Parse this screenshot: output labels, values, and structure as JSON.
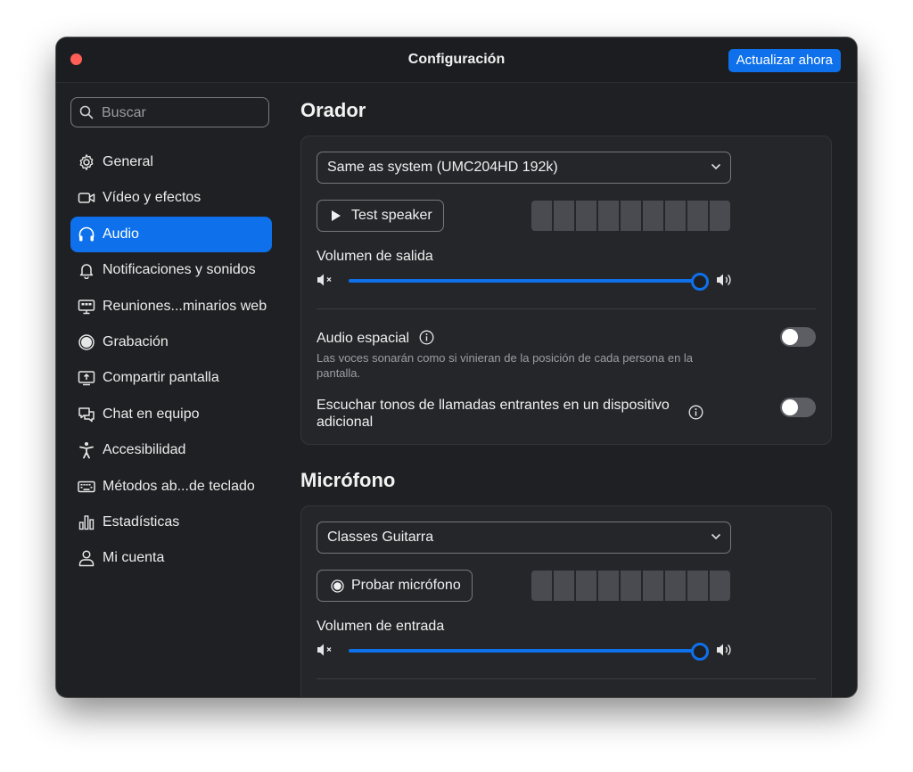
{
  "window": {
    "title": "Configuración",
    "update_button": "Actualizar ahora"
  },
  "search": {
    "placeholder": "Buscar"
  },
  "sidebar": {
    "items": [
      {
        "label": "General",
        "icon": "gear-icon"
      },
      {
        "label": "Vídeo y efectos",
        "icon": "video-icon"
      },
      {
        "label": "Audio",
        "icon": "headphones-icon",
        "active": true
      },
      {
        "label": "Notificaciones y sonidos",
        "icon": "bell-icon"
      },
      {
        "label": "Reuniones...minarios web",
        "icon": "meeting-icon"
      },
      {
        "label": "Grabación",
        "icon": "record-icon"
      },
      {
        "label": "Compartir pantalla",
        "icon": "share-screen-icon"
      },
      {
        "label": "Chat en equipo",
        "icon": "chat-icon"
      },
      {
        "label": "Accesibilidad",
        "icon": "accessibility-icon"
      },
      {
        "label": "Métodos ab...de teclado",
        "icon": "keyboard-icon"
      },
      {
        "label": "Estadísticas",
        "icon": "stats-icon"
      },
      {
        "label": "Mi cuenta",
        "icon": "person-icon"
      }
    ]
  },
  "speaker": {
    "title": "Orador",
    "device": "Same as system (UMC204HD 192k)",
    "test_button": "Test speaker",
    "volume_label": "Volumen de salida",
    "volume_level": 1.0,
    "spatial_label": "Audio espacial",
    "spatial_desc": "Las voces sonarán como si vinieran de la posición de cada persona en la pantalla.",
    "spatial_on": false,
    "ring_label": "Escuchar tonos de llamadas entrantes en un dispositivo adicional",
    "ring_on": false
  },
  "mic": {
    "title": "Micrófono",
    "device": "Classes Guitarra",
    "test_button": "Probar micrófono",
    "volume_label": "Volumen de entrada",
    "volume_level": 1.0
  },
  "colors": {
    "accent": "#0e71eb",
    "background": "#1f2023",
    "card": "#25262a",
    "close": "#ff5f57"
  }
}
